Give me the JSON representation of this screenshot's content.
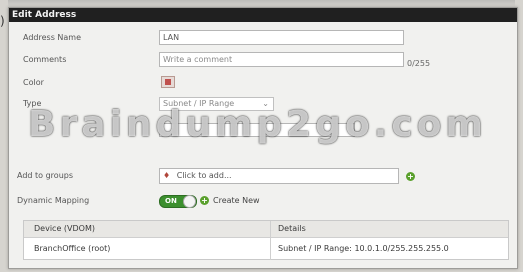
{
  "edge_char": ")",
  "dialog": {
    "title": "Edit Address",
    "fields": {
      "address_name_label": "Address Name",
      "address_name_value": "LAN",
      "comments_label": "Comments",
      "comments_placeholder": "Write a comment",
      "comments_counter": "0/255",
      "color_label": "Color",
      "type_label": "Type",
      "type_value": "Subnet / IP Range",
      "add_to_groups_label": "Add to groups",
      "add_to_groups_value": "Click to add...",
      "dynamic_mapping_label": "Dynamic Mapping",
      "toggle_state": "ON",
      "create_new": "Create New"
    },
    "table": {
      "headers": [
        "Device (VDOM)",
        "Details"
      ],
      "rows": [
        [
          "BranchOffice (root)",
          "Subnet / IP Range: 10.0.1.0/255.255.255.0"
        ]
      ]
    }
  },
  "watermark": "Braindump2go.com",
  "colors": {
    "titlebar": "#202020",
    "toggle_on": "#3c8f2e",
    "plus_icon": "#5aa02c",
    "color_swatch": "#c0504d"
  }
}
